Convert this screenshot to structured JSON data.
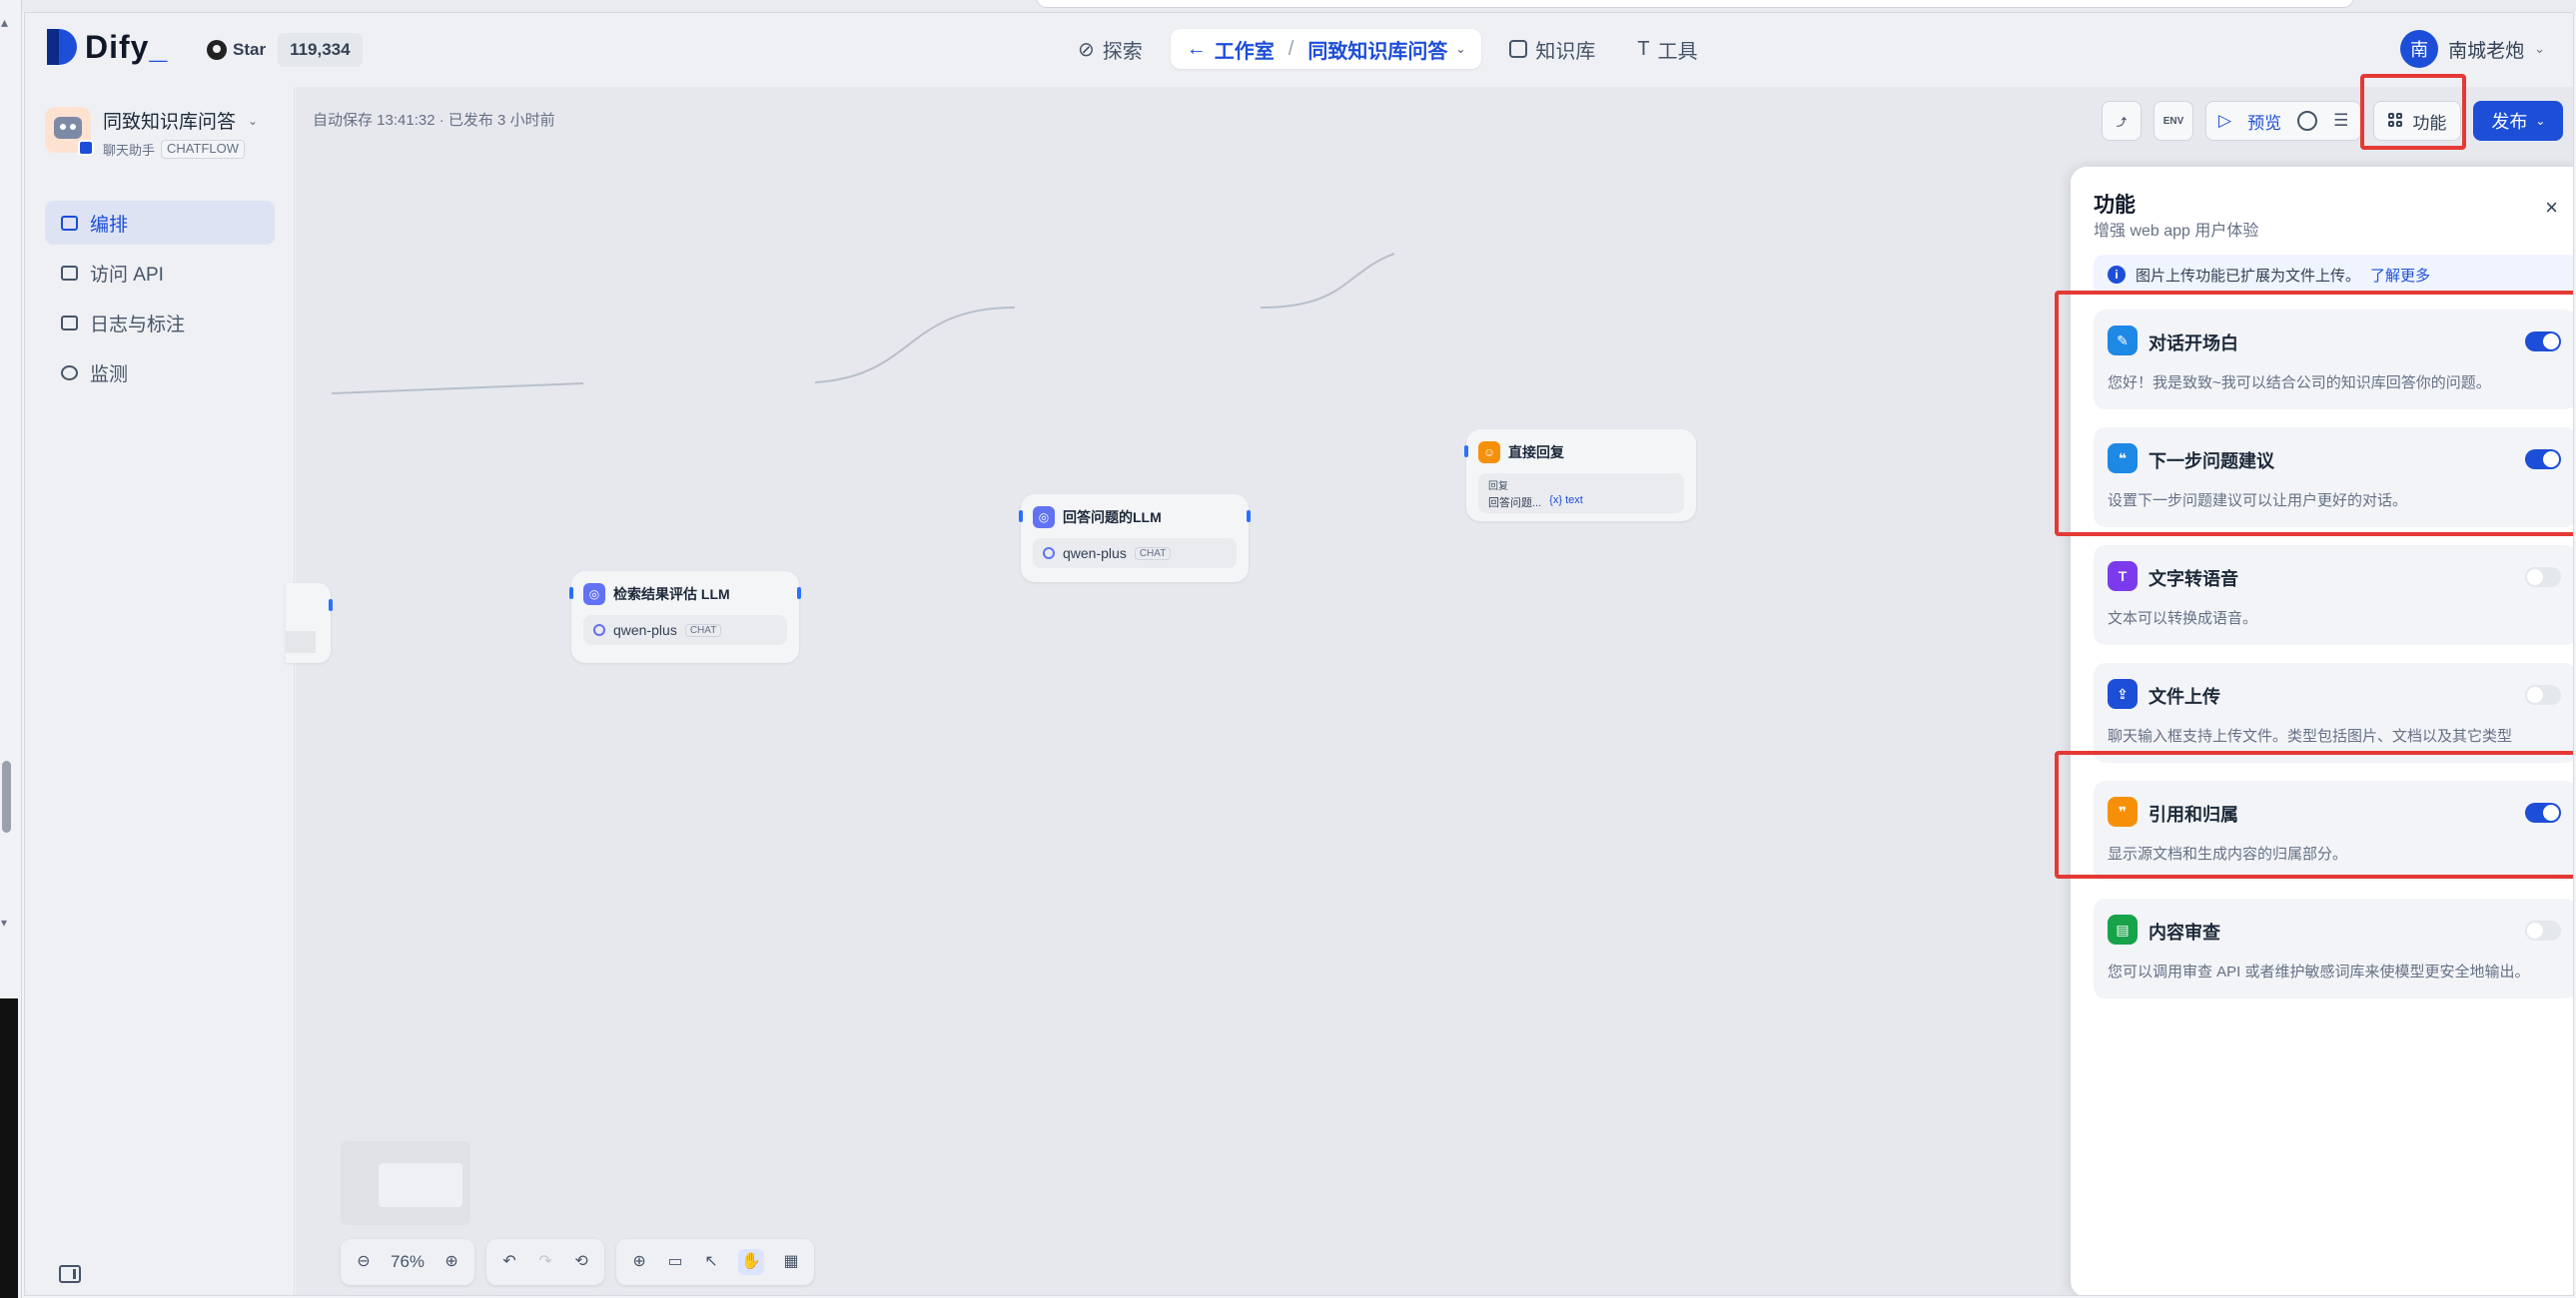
{
  "header": {
    "logo_text": "Dify",
    "github_star_label": "Star",
    "github_star_count": "119,334",
    "nav_explore": "探索",
    "nav_studio": "工作室",
    "nav_app": "同致知识库问答",
    "nav_knowledge": "知识库",
    "nav_tools": "工具",
    "user_avatar": "南",
    "user_name": "南城老炮"
  },
  "sidebar": {
    "app_name": "同致知识库问答",
    "app_type": "聊天助手",
    "app_mode": "CHATFLOW",
    "items": [
      {
        "label": "编排"
      },
      {
        "label": "访问 API"
      },
      {
        "label": "日志与标注"
      },
      {
        "label": "监测"
      }
    ]
  },
  "canvas": {
    "save_status": "自动保存 13:41:32 · 已发布 3 小时前",
    "nodes": [
      {
        "title": "检索结果评估 LLM",
        "model": "qwen-plus",
        "badge": "CHAT"
      },
      {
        "title": "回答问题的LLM",
        "model": "qwen-plus",
        "badge": "CHAT"
      },
      {
        "title": "直接回复",
        "sub_label": "回复",
        "var": "回答问题...",
        "var2": "{x} text"
      }
    ],
    "zoom": "76%"
  },
  "toolbar_right": {
    "env_label": "ENV",
    "preview_label": "预览",
    "features_label": "功能",
    "publish_label": "发布"
  },
  "panel": {
    "title": "功能",
    "subtitle": "增强 web app 用户体验",
    "info_text": "图片上传功能已扩展为文件上传。",
    "info_link": "了解更多",
    "features": [
      {
        "name": "对话开场白",
        "desc": "您好！我是致致~我可以结合公司的知识库回答你的问题。",
        "enabled": true,
        "color": "#1e88e5"
      },
      {
        "name": "下一步问题建议",
        "desc": "设置下一步问题建议可以让用户更好的对话。",
        "enabled": true,
        "color": "#1e88e5"
      },
      {
        "name": "文字转语音",
        "desc": "文本可以转换成语音。",
        "enabled": false,
        "color": "#7c3aed"
      },
      {
        "name": "文件上传",
        "desc": "聊天输入框支持上传文件。类型包括图片、文档以及其它类型",
        "enabled": false,
        "color": "#1d4ed8"
      },
      {
        "name": "引用和归属",
        "desc": "显示源文档和生成内容的归属部分。",
        "enabled": true,
        "color": "#f79009"
      },
      {
        "name": "内容审查",
        "desc": "您可以调用审查 API 或者维护敏感词库来使模型更安全地输出。",
        "enabled": false,
        "color": "#16a34a"
      }
    ]
  }
}
